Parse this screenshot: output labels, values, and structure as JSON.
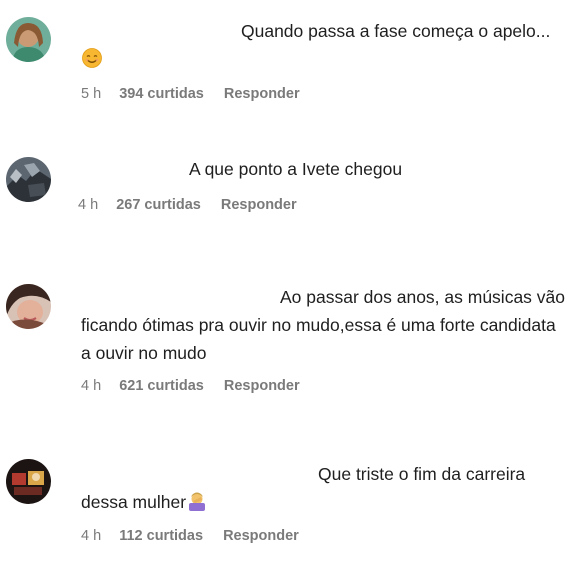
{
  "comments": [
    {
      "text": "Quando passa a fase começa o apelo...",
      "emoji": "smiling-face-emoji",
      "time": "5 h",
      "likes": "394 curtidas",
      "reply": "Responder"
    },
    {
      "text": "A que ponto a Ivete chegou",
      "time": "4 h",
      "likes": "267 curtidas",
      "reply": "Responder"
    },
    {
      "text": "Ao passar dos anos, as músicas vão ficando ótimas pra ouvir no mudo,essa é uma forte candidata a ouvir no mudo",
      "time": "4 h",
      "likes": "621 curtidas",
      "reply": "Responder"
    },
    {
      "text": "Que triste o fim da carreira dessa mulher",
      "emoji": "facepalm-emoji",
      "time": "4 h",
      "likes": "112 curtidas",
      "reply": "Responder"
    }
  ],
  "colors": {
    "meta_text": "#7a7a7a",
    "comment_text": "#1f1f1f",
    "background": "#ffffff"
  }
}
